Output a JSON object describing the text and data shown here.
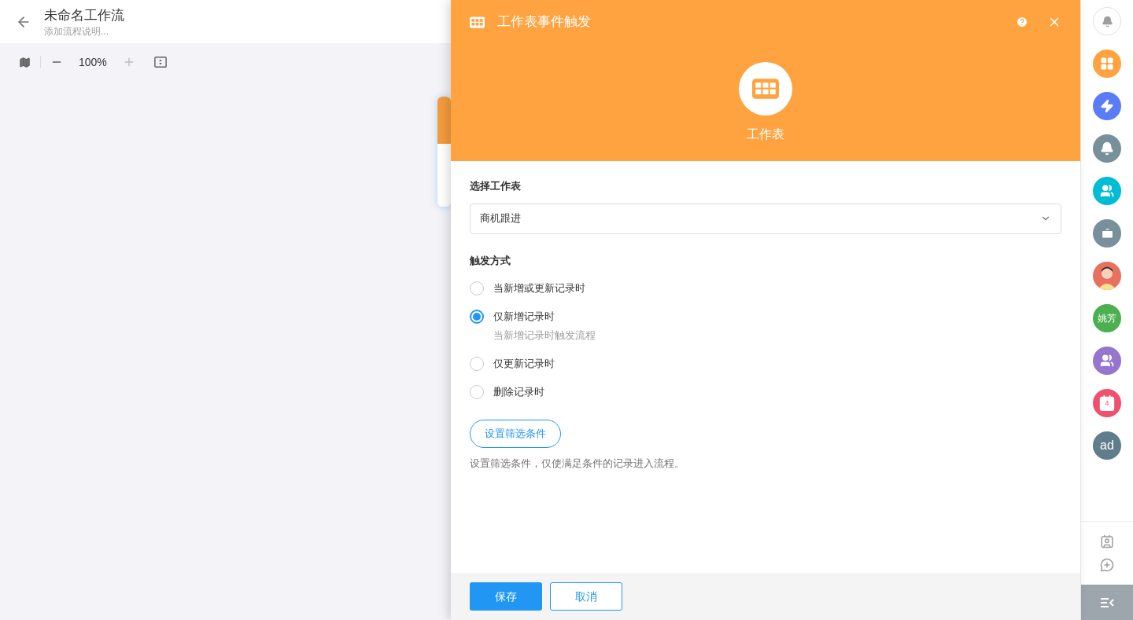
{
  "header": {
    "title": "未命名工作流",
    "description_placeholder": "添加流程说明..."
  },
  "toolbar": {
    "zoom": "100%"
  },
  "panel": {
    "title": "工作表事件触发",
    "node_label": "工作表",
    "worksheet_label": "选择工作表",
    "worksheet_value": "商机跟进",
    "trigger_label": "触发方式",
    "options": [
      {
        "label": "当新增或更新记录时",
        "selected": false
      },
      {
        "label": "仅新增记录时",
        "selected": true,
        "hint": "当新增记录时触发流程"
      },
      {
        "label": "仅更新记录时",
        "selected": false
      },
      {
        "label": "删除记录时",
        "selected": false
      }
    ],
    "filter_button": "设置筛选条件",
    "filter_hint": "设置筛选条件，仅使满足条件的记录进入流程。",
    "buttons": [
      "保存",
      "取消"
    ]
  },
  "sidebar": {
    "items": [
      {
        "kind": "notice",
        "color": "#ffffff"
      },
      {
        "kind": "apps",
        "color": "#ffa340"
      },
      {
        "kind": "spark",
        "color": "#5b7cf7"
      },
      {
        "kind": "bell",
        "color": "#78909c"
      },
      {
        "kind": "group",
        "color": "#00bcd4"
      },
      {
        "kind": "case",
        "color": "#78909c"
      },
      {
        "kind": "avatar",
        "color": "#e8705f"
      },
      {
        "kind": "text",
        "color": "#4caf50",
        "label": "姚芳"
      },
      {
        "kind": "group",
        "color": "#9575cd"
      },
      {
        "kind": "calendar",
        "color": "#f0506e",
        "label": "4"
      },
      {
        "kind": "text",
        "color": "#607d8b",
        "label": "ad"
      }
    ]
  }
}
